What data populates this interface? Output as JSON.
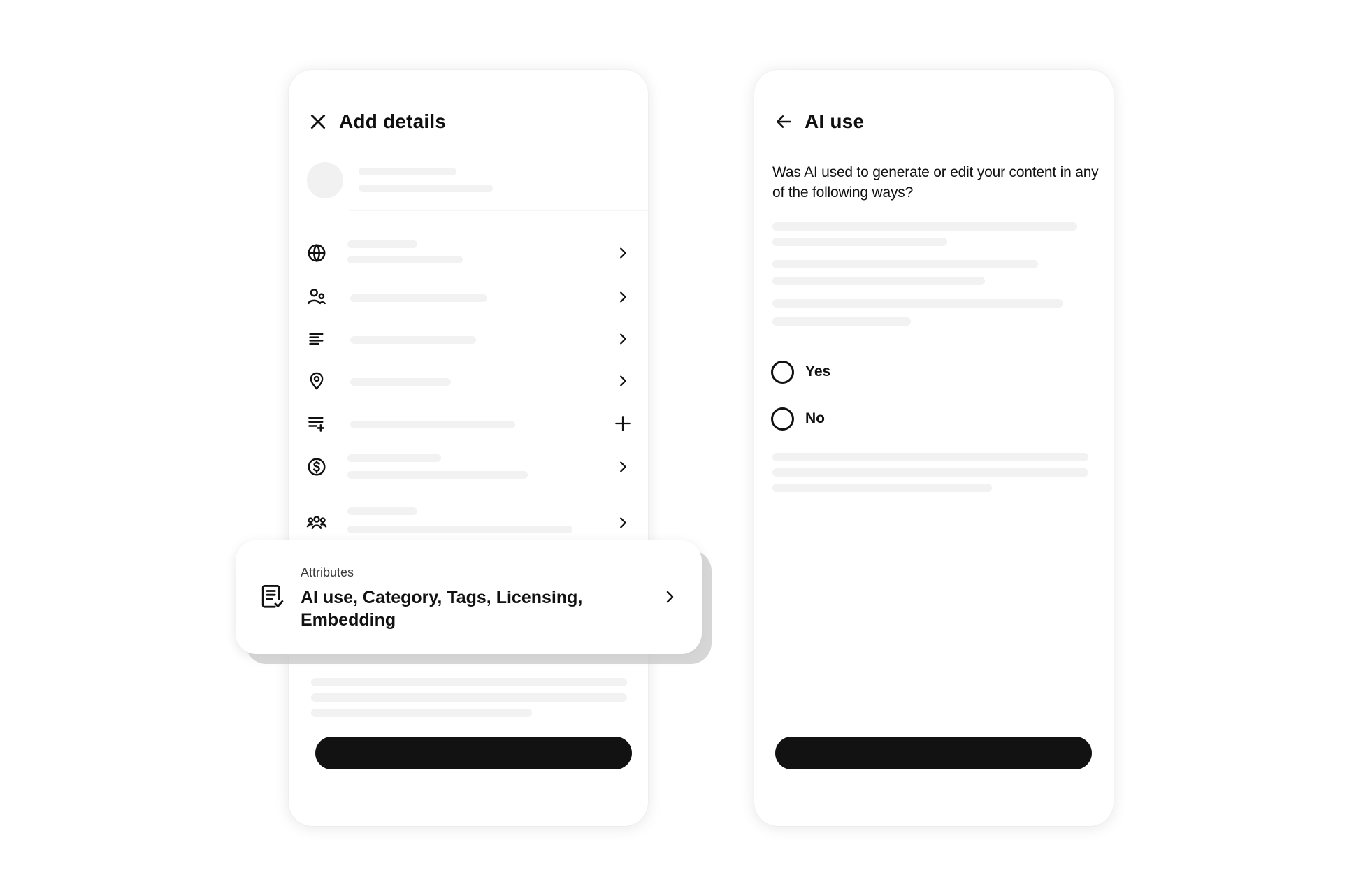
{
  "left_screen": {
    "title": "Add details",
    "rows": [
      {
        "icon": "globe-icon",
        "trailing": "chevron-right-icon"
      },
      {
        "icon": "people-icon",
        "trailing": "chevron-right-icon"
      },
      {
        "icon": "text-lines-icon",
        "trailing": "chevron-right-icon"
      },
      {
        "icon": "location-pin-icon",
        "trailing": "chevron-right-icon"
      },
      {
        "icon": "playlist-add-icon",
        "trailing": "plus-icon"
      },
      {
        "icon": "dollar-coin-icon",
        "trailing": "chevron-right-icon"
      },
      {
        "icon": "group-icon",
        "trailing": "chevron-right-icon"
      }
    ],
    "attributes_card": {
      "label": "Attributes",
      "value": "AI use, Category, Tags, Licensing, Embedding",
      "icon": "document-check-icon",
      "trailing": "chevron-right-icon"
    }
  },
  "right_screen": {
    "title": "AI use",
    "question": "Was AI used to generate or edit your content in any of the following ways?",
    "options": [
      {
        "label": "Yes",
        "selected": false
      },
      {
        "label": "No",
        "selected": false
      }
    ]
  },
  "colors": {
    "primary_button": "#121212",
    "skeleton": "#f2f2f2",
    "background": "#ffffff"
  }
}
